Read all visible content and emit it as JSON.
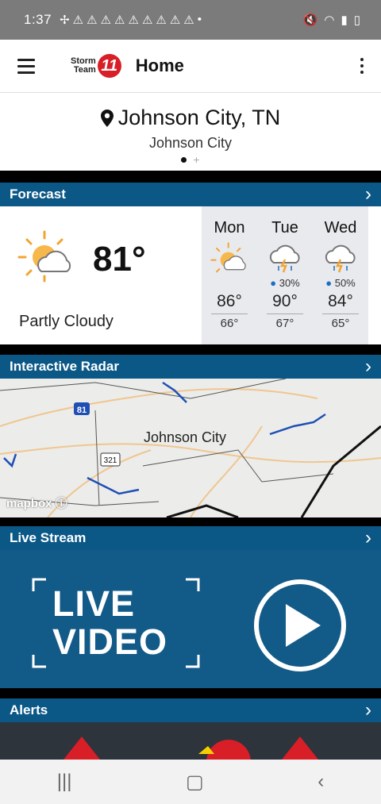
{
  "status_bar": {
    "time": "1:37"
  },
  "app_bar": {
    "title": "Home",
    "logo_line1": "Storm",
    "logo_line2": "Team",
    "logo_badge": "11"
  },
  "location": {
    "city": "Johnson City, TN",
    "subtitle": "Johnson City"
  },
  "forecast": {
    "header": "Forecast",
    "current": {
      "temp": "81°",
      "condition": "Partly Cloudy"
    },
    "days": [
      {
        "name": "Mon",
        "icon": "partly-cloudy-icon",
        "precip": "",
        "hi": "86°",
        "lo": "66°"
      },
      {
        "name": "Tue",
        "icon": "thunderstorm-icon",
        "precip": "30%",
        "hi": "90°",
        "lo": "67°"
      },
      {
        "name": "Wed",
        "icon": "thunderstorm-icon",
        "precip": "50%",
        "hi": "84°",
        "lo": "65°"
      }
    ]
  },
  "radar": {
    "header": "Interactive Radar",
    "map_city": "Johnson City",
    "attribution": "mapbox",
    "interstate": "81",
    "route": "321"
  },
  "live": {
    "header": "Live Stream",
    "line1": "LIVE",
    "line2": "VIDEO"
  },
  "alerts": {
    "header": "Alerts"
  },
  "colors": {
    "section_bar": "#0b5887",
    "live_bg": "#125a88",
    "brand_red": "#d81e27"
  }
}
